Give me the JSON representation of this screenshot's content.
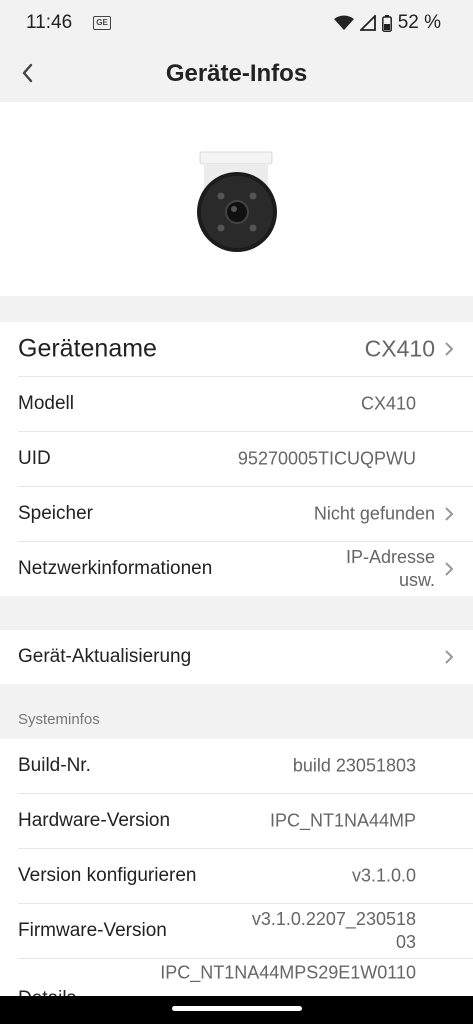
{
  "status": {
    "time": "11:46",
    "battery": "52 %",
    "notif": "GE"
  },
  "header": {
    "title": "Geräte-Infos"
  },
  "device": {
    "name_label": "Gerätename",
    "name_value": "CX410",
    "model_label": "Modell",
    "model_value": "CX410",
    "uid_label": "UID",
    "uid_value": "95270005TICUQPWU",
    "storage_label": "Speicher",
    "storage_value": "Nicht gefunden",
    "network_label": "Netzwerkinformationen",
    "network_value_1": "IP-Adresse",
    "network_value_2": "usw."
  },
  "update": {
    "label": "Gerät-Aktualisierung"
  },
  "system": {
    "section_title": "Systeminfos",
    "build_label": "Build-Nr.",
    "build_value": "build 23051803",
    "hw_label": "Hardware-Version",
    "hw_value": "IPC_NT1NA44MP",
    "config_label": "Version konfigurieren",
    "config_value": "v3.1.0.0",
    "fw_label": "Firmware-Version",
    "fw_value_1": "v3.1.0.2207_230518",
    "fw_value_2": "03",
    "details_label": "Details",
    "details_value": "IPC_NT1NA44MPS29E1W0110"
  }
}
